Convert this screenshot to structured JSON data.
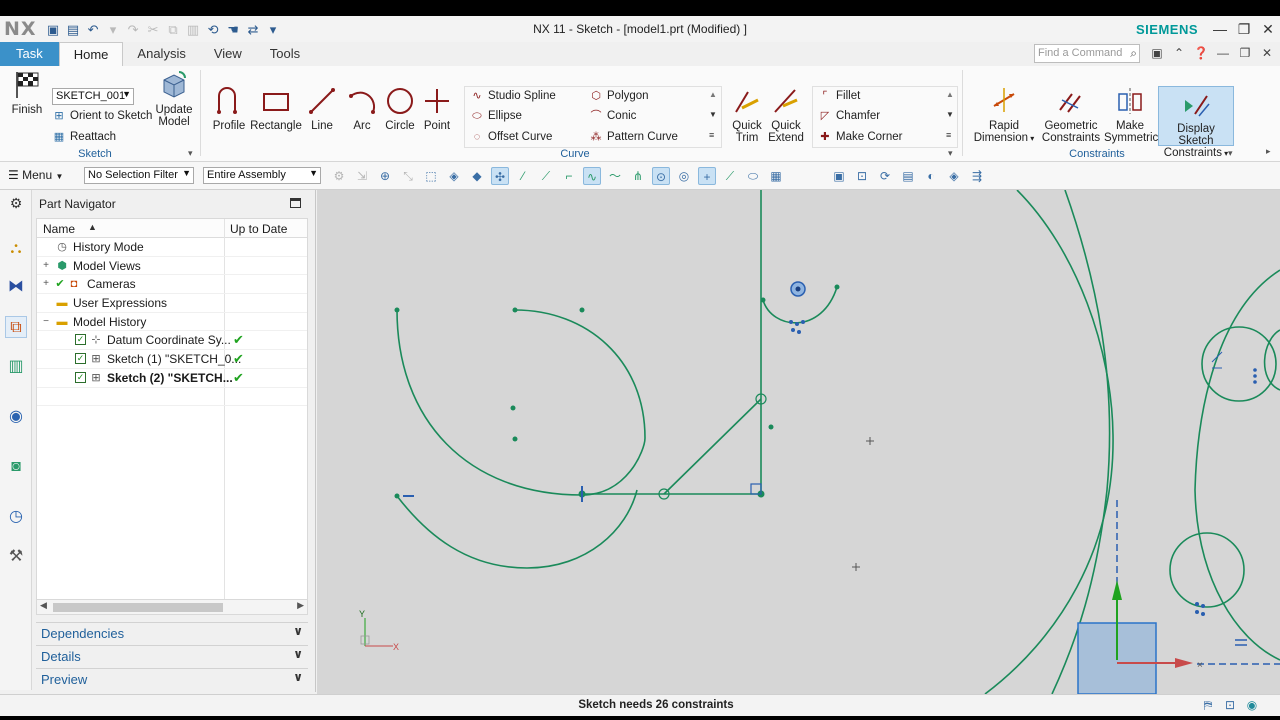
{
  "window": {
    "logo": "NX",
    "title": "NX 11 - Sketch - [model1.prt (Modified) ]",
    "brand": "SIEMENS"
  },
  "tabs": [
    "Task",
    "Home",
    "Analysis",
    "View",
    "Tools"
  ],
  "search": {
    "placeholder": "Find a Command"
  },
  "ribbon": {
    "sketch_group": {
      "label": "Sketch",
      "sketch_name": "SKETCH_001",
      "finish": "Finish",
      "orient": "Orient to Sketch",
      "reattach": "Reattach",
      "update_model": "Update Model"
    },
    "curve_group": {
      "label": "Curve",
      "profile": "Profile",
      "rectangle": "Rectangle",
      "line": "Line",
      "arc": "Arc",
      "circle": "Circle",
      "point": "Point",
      "studio_spline": "Studio Spline",
      "ellipse": "Ellipse",
      "offset_curve": "Offset Curve",
      "polygon": "Polygon",
      "conic": "Conic",
      "pattern_curve": "Pattern Curve",
      "quick_trim": "Quick Trim",
      "quick_extend": "Quick Extend",
      "fillet": "Fillet",
      "chamfer": "Chamfer",
      "make_corner": "Make Corner"
    },
    "constraints_group": {
      "label": "Constraints",
      "rapid_dimension": "Rapid Dimension",
      "geometric_constraints": "Geometric Constraints",
      "make_symmetric": "Make Symmetric",
      "display_sketch_constraints": "Display Sketch Constraints"
    }
  },
  "commandbar": {
    "menu": "Menu",
    "selection_filter": "No Selection Filter",
    "scope": "Entire Assembly"
  },
  "navigator": {
    "title": "Part Navigator",
    "col_name": "Name",
    "col_status": "Up to Date",
    "rows": [
      {
        "label": "History Mode"
      },
      {
        "label": "Model Views"
      },
      {
        "label": "Cameras"
      },
      {
        "label": "User Expressions"
      },
      {
        "label": "Model History"
      },
      {
        "label": "Datum Coordinate Sy..."
      },
      {
        "label": "Sketch (1) \"SKETCH_0..."
      },
      {
        "label": "Sketch (2) \"SKETCH..."
      }
    ],
    "panels": [
      "Dependencies",
      "Details",
      "Preview"
    ]
  },
  "canvas": {
    "axis_x": "X",
    "axis_y": "Y"
  },
  "status": {
    "message": "Sketch needs 26 constraints"
  },
  "colors": {
    "sketch_curve": "#1a8a5a",
    "constraint": "#2a5fb0",
    "accent": "#3b91c9"
  }
}
